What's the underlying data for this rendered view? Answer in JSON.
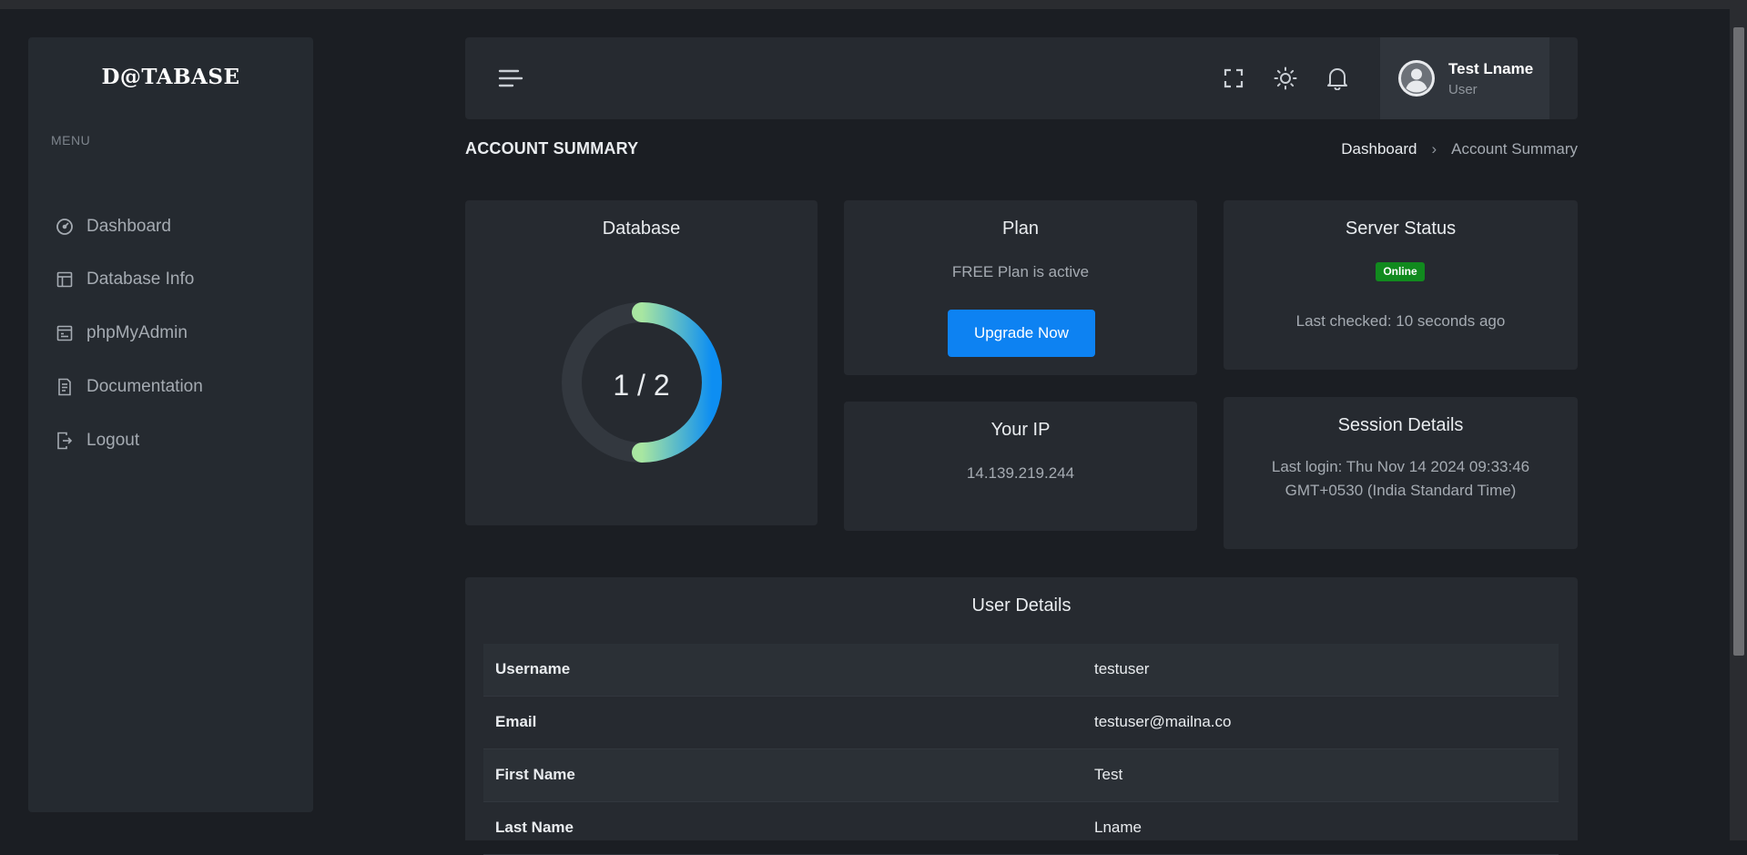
{
  "sidebar": {
    "logo": "D@TABASE",
    "menu_title": "MENU",
    "items": [
      {
        "label": "Dashboard",
        "icon": "dashboard-gauge-icon"
      },
      {
        "label": "Database Info",
        "icon": "layout-icon"
      },
      {
        "label": "phpMyAdmin",
        "icon": "browser-window-icon"
      },
      {
        "label": "Documentation",
        "icon": "document-icon"
      },
      {
        "label": "Logout",
        "icon": "logout-icon"
      }
    ]
  },
  "header": {
    "icons": [
      "menu-icon",
      "fullscreen-icon",
      "sun-icon",
      "bell-icon"
    ],
    "user": {
      "name": "Test Lname",
      "role": "User"
    }
  },
  "page": {
    "title": "ACCOUNT SUMMARY",
    "breadcrumb": {
      "parent": "Dashboard",
      "separator": "›",
      "current": "Account Summary"
    }
  },
  "cards": {
    "database": {
      "title": "Database",
      "used": 1,
      "total": 2,
      "label": "1 / 2"
    },
    "plan": {
      "title": "Plan",
      "status_text": "FREE Plan is active",
      "button_label": "Upgrade Now"
    },
    "server_status": {
      "title": "Server Status",
      "badge": "Online",
      "last_checked": "Last checked: 10 seconds ago"
    },
    "your_ip": {
      "title": "Your IP",
      "ip": "14.139.219.244"
    },
    "session": {
      "title": "Session Details",
      "line1": "Last login: Thu Nov 14 2024 09:33:46",
      "line2": "GMT+0530 (India Standard Time)"
    }
  },
  "user_details": {
    "title": "User Details",
    "rows": [
      {
        "key": "Username",
        "value": "testuser"
      },
      {
        "key": "Email",
        "value": "testuser@mailna.co"
      },
      {
        "key": "First Name",
        "value": "Test"
      },
      {
        "key": "Last Name",
        "value": "Lname"
      }
    ]
  },
  "colors": {
    "background": "#1b1e23",
    "panel": "#262a30",
    "primary_button": "#0d82f2",
    "online_badge": "#118a1e",
    "ring_gradient_start": "#a8e6a1",
    "ring_gradient_end": "#0d8ef2"
  }
}
